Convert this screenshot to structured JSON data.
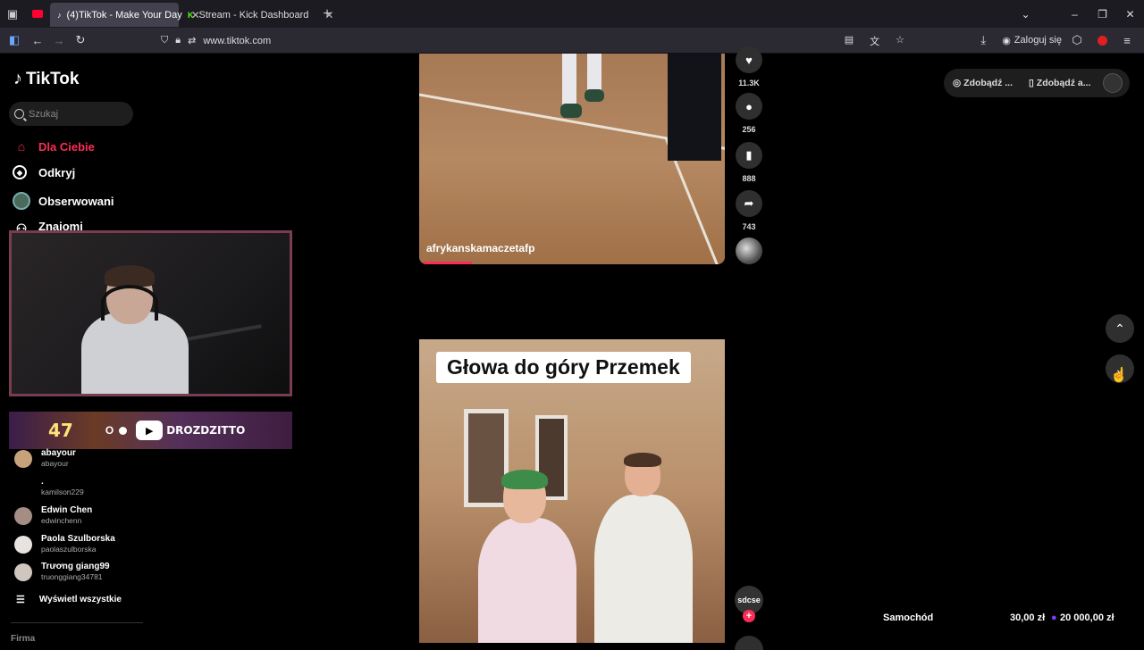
{
  "browser": {
    "tabs": [
      {
        "title": "(4)TikTok - Make Your Day",
        "active": true
      },
      {
        "title": "Stream - Kick Dashboard",
        "active": false
      }
    ],
    "url": "www.tiktok.com",
    "login_label": "Zaloguj się"
  },
  "sidebar": {
    "logo": "TikTok",
    "search_placeholder": "Szukaj",
    "nav": [
      {
        "label": "Dla Ciebie",
        "active": true,
        "icon": "home-icon"
      },
      {
        "label": "Odkryj",
        "active": false,
        "icon": "compass-icon"
      },
      {
        "label": "Obserwowani",
        "active": false,
        "icon": "avatar-icon"
      },
      {
        "label": "Znajomi",
        "active": false,
        "icon": "friends-icon"
      }
    ],
    "overlay_banner": {
      "number": "47",
      "text": "DROZDZITTO",
      "letter": "O"
    },
    "accounts": [
      {
        "name": "abayour",
        "handle": "abayour"
      },
      {
        "name": ".",
        "handle": "kamilson229"
      },
      {
        "name": "Edwin Chen",
        "handle": "edwinchenn"
      },
      {
        "name": "Paola Szulborska",
        "handle": "paolaszulborska"
      },
      {
        "name": "Trương giang99",
        "handle": "truonggiang34781"
      }
    ],
    "show_all": "Wyświetl wszystkie",
    "footer_heading": "Firma"
  },
  "feed": {
    "video1": {
      "username": "afrykanskamaczetafp",
      "progress_percent": 16
    },
    "video1_actions": {
      "likes": "11.3K",
      "comments": "256",
      "saves": "888",
      "shares": "743"
    },
    "video2": {
      "caption_overlay": "Głowa do góry Przemek",
      "author_avatar_text": "sdcse"
    }
  },
  "topright": {
    "get_coins": "Zdobądź ...",
    "get_app": "Zdobądź a..."
  },
  "donation": {
    "label": "Samochód",
    "amount": "30,00 zł",
    "goal": "20 000,00 zł"
  },
  "colors": {
    "accent": "#fe2c55",
    "background": "#000000"
  }
}
